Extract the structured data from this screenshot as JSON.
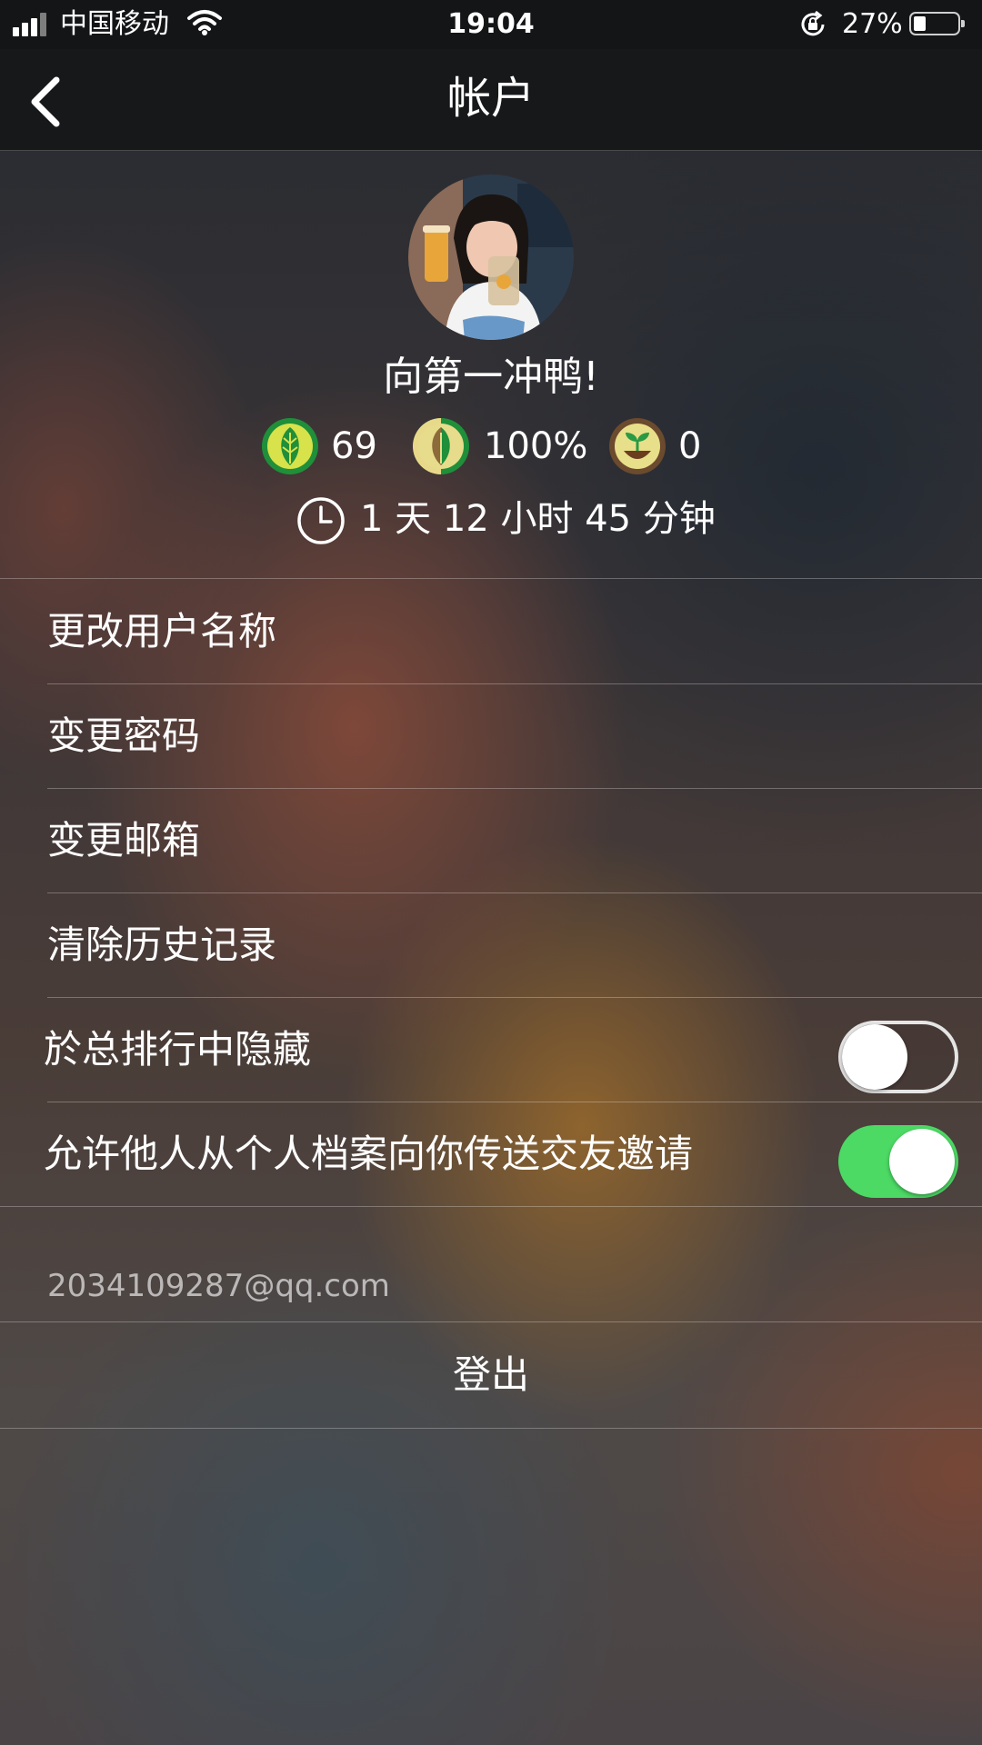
{
  "status_bar": {
    "carrier": "中国移动",
    "time": "19:04",
    "battery_percent": "27%",
    "battery_level": 0.27
  },
  "nav": {
    "title": "帐户",
    "back_icon": "chevron-left-icon"
  },
  "profile": {
    "username": "向第一冲鸭!",
    "stats": [
      {
        "icon": "green-leaf-icon",
        "value": "69"
      },
      {
        "icon": "half-leaf-icon",
        "value": "100%"
      },
      {
        "icon": "sprout-icon",
        "value": "0"
      }
    ],
    "total_time": "1 天 12 小时 45 分钟"
  },
  "menu": {
    "change_username": "更改用户名称",
    "change_password": "变更密码",
    "change_email": "变更邮箱",
    "clear_history": "清除历史记录",
    "hide_in_ranking": {
      "label": "於总排行中隐藏",
      "on": false
    },
    "allow_friend_invites": {
      "label": "允许他人从个人档案向你传送交友邀请",
      "on": true
    }
  },
  "account": {
    "email": "2034109287@qq.com",
    "logout": "登出"
  },
  "colors": {
    "toggle_on": "#4cd964",
    "leaf_green": "#1f8f3a",
    "leaf_yellow": "#d8e24a"
  }
}
